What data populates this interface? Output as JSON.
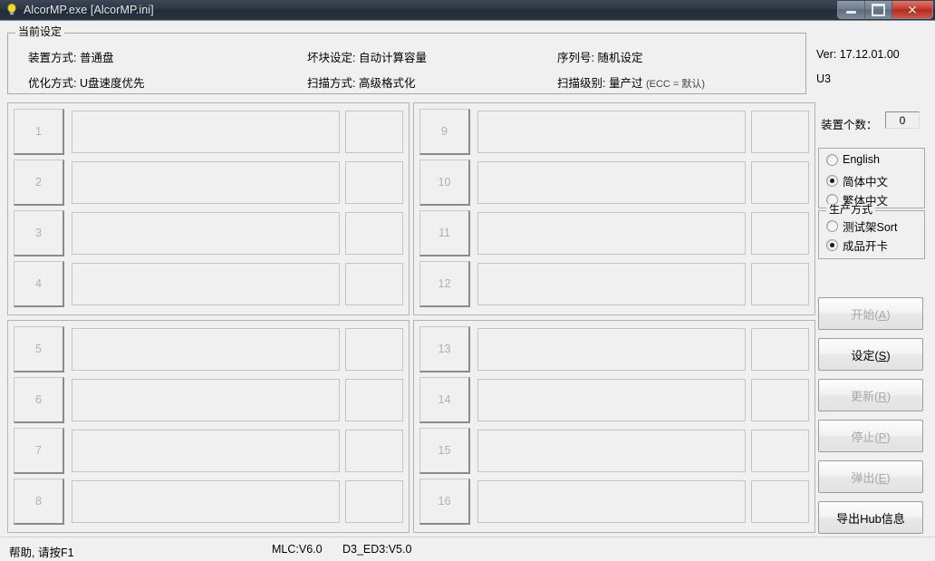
{
  "window": {
    "title": "AlcorMP.exe [AlcorMP.ini]",
    "icon": "lightbulb-icon",
    "controls": {
      "minimize": "minimize-icon",
      "maximize": "maximize-icon",
      "close": "✕"
    }
  },
  "current_settings": {
    "group_title": "当前设定",
    "rows": [
      {
        "label": "装置方式:",
        "value": "普通盘"
      },
      {
        "label": "优化方式:",
        "value": "U盘速度优先"
      },
      {
        "label": "坏块设定:",
        "value": "自动计算容量"
      },
      {
        "label": "扫描方式:",
        "value": "高级格式化"
      },
      {
        "label": "序列号:",
        "value": "随机设定"
      },
      {
        "label": "扫描级别:",
        "value": "量产过",
        "suffix": "(ECC = 默认)"
      }
    ],
    "device_mode": "装置方式: 普通盘",
    "optimize_mode": "优化方式: U盘速度优先",
    "badblock_setting": "坏块设定: 自动计算容量",
    "scan_mode": "扫描方式: 高级格式化",
    "serial_number": "序列号: 随机设定",
    "scan_level": "扫描级别: 量产过",
    "scan_level_note": "(ECC = 默认)"
  },
  "devices": {
    "panels": [
      {
        "slots": [
          {
            "no": "1",
            "info": "",
            "size": ""
          },
          {
            "no": "2",
            "info": "",
            "size": ""
          },
          {
            "no": "3",
            "info": "",
            "size": ""
          },
          {
            "no": "4",
            "info": "",
            "size": ""
          }
        ]
      },
      {
        "slots": [
          {
            "no": "9",
            "info": "",
            "size": ""
          },
          {
            "no": "10",
            "info": "",
            "size": ""
          },
          {
            "no": "11",
            "info": "",
            "size": ""
          },
          {
            "no": "12",
            "info": "",
            "size": ""
          }
        ]
      },
      {
        "slots": [
          {
            "no": "5",
            "info": "",
            "size": ""
          },
          {
            "no": "6",
            "info": "",
            "size": ""
          },
          {
            "no": "7",
            "info": "",
            "size": ""
          },
          {
            "no": "8",
            "info": "",
            "size": ""
          }
        ]
      },
      {
        "slots": [
          {
            "no": "13",
            "info": "",
            "size": ""
          },
          {
            "no": "14",
            "info": "",
            "size": ""
          },
          {
            "no": "15",
            "info": "",
            "size": ""
          },
          {
            "no": "16",
            "info": "",
            "size": ""
          }
        ]
      }
    ]
  },
  "sidebar": {
    "version": "Ver: 17.12.01.00",
    "mode": "U3",
    "device_count_label": "装置个数：",
    "device_count_value": "0",
    "language": {
      "options": [
        {
          "label": "English",
          "selected": false
        },
        {
          "label": "简体中文",
          "selected": true
        },
        {
          "label": "繁体中文",
          "selected": false
        }
      ]
    },
    "production": {
      "group_title": "生产方式",
      "options": [
        {
          "label": "测试架Sort",
          "selected": false
        },
        {
          "label": "成品开卡",
          "selected": true
        }
      ]
    },
    "buttons": [
      {
        "label": "开始(A)",
        "text": "开始(",
        "key": "A",
        "tail": ")",
        "enabled": false
      },
      {
        "label": "设定(S)",
        "text": "设定(",
        "key": "S",
        "tail": ")",
        "enabled": true
      },
      {
        "label": "更新(R)",
        "text": "更新(",
        "key": "R",
        "tail": ")",
        "enabled": false
      },
      {
        "label": "停止(P)",
        "text": "停止(",
        "key": "P",
        "tail": ")",
        "enabled": false
      },
      {
        "label": "弹出(E)",
        "text": "弹出(",
        "key": "E",
        "tail": ")",
        "enabled": false
      },
      {
        "label": "导出Hub信息",
        "text": "导出Hub信息",
        "key": "",
        "tail": "",
        "enabled": true
      }
    ]
  },
  "statusbar": {
    "help": "帮助, 请按F1",
    "mlc": "MLC:V6.0",
    "d3": "D3_ED3:V5.0"
  }
}
